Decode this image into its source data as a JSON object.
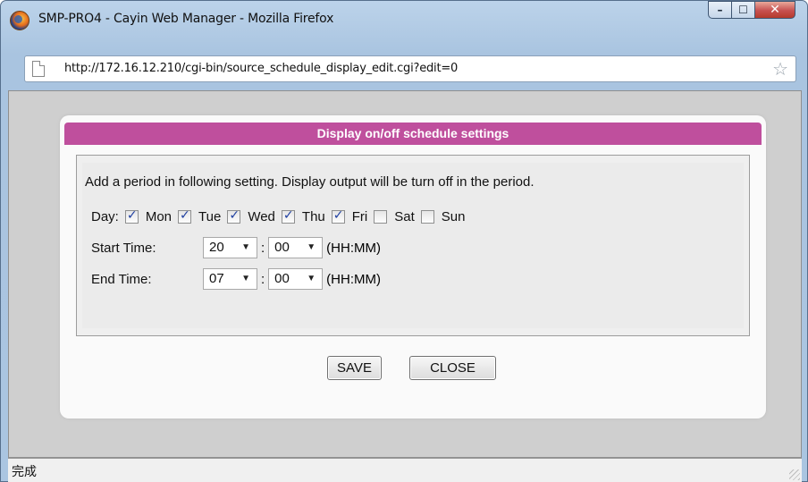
{
  "window": {
    "title": "SMP-PRO4 - Cayin Web Manager - Mozilla Firefox",
    "icon": "firefox-icon",
    "controls": {
      "minimize": "–",
      "maximize": "☐",
      "close": "✕"
    }
  },
  "address_bar": {
    "url": "http://172.16.12.210/cgi-bin/source_schedule_display_edit.cgi?edit=0",
    "bookmark_icon": "star-icon"
  },
  "dialog": {
    "header": "Display on/off schedule settings",
    "instruction": "Add a period in following setting. Display output will be turn off in the period.",
    "day_label": "Day:",
    "days": [
      {
        "label": "Mon",
        "checked": true
      },
      {
        "label": "Tue",
        "checked": true
      },
      {
        "label": "Wed",
        "checked": true
      },
      {
        "label": "Thu",
        "checked": true
      },
      {
        "label": "Fri",
        "checked": true
      },
      {
        "label": "Sat",
        "checked": false
      },
      {
        "label": "Sun",
        "checked": false
      }
    ],
    "start_time": {
      "label": "Start Time:",
      "hour": "20",
      "minute": "00",
      "unit": "(HH:MM)"
    },
    "end_time": {
      "label": "End Time:",
      "hour": "07",
      "minute": "00",
      "unit": "(HH:MM)"
    },
    "save_label": "SAVE",
    "close_label": "CLOSE"
  },
  "status_bar": {
    "text": "完成"
  },
  "colors": {
    "header_bg": "#bf4f9d",
    "titlebar_bg": "#aac5e1"
  }
}
